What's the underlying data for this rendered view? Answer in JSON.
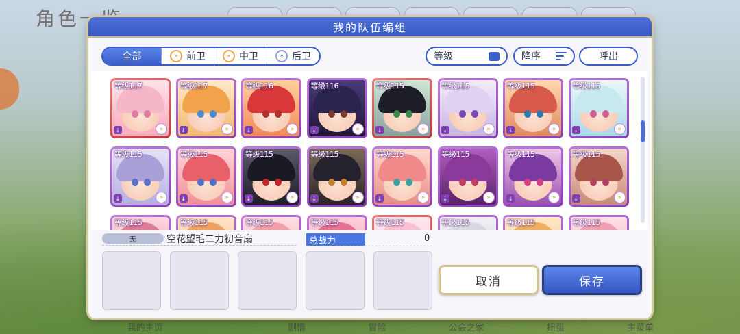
{
  "background": {
    "title": "角色一览",
    "bottom_nav": [
      "我的主页",
      "",
      "剧情",
      "冒险",
      "公会之家",
      "扭蛋",
      "主菜单"
    ]
  },
  "dialog": {
    "title": "我的队伍编组",
    "tabs": [
      {
        "label": "全部",
        "active": true
      },
      {
        "label": "前卫",
        "icon": "vanguard-icon"
      },
      {
        "label": "中卫",
        "icon": "midguard-icon"
      },
      {
        "label": "后卫",
        "icon": "rearguard-icon"
      }
    ],
    "sort_field": "等级",
    "sort_order": "降序",
    "call_button": "呼出",
    "characters": [
      {
        "level": "等级117",
        "frame": "red",
        "hair": "#f5b7c8",
        "eyes": "#e07aa0",
        "bg1": "#ffe3ea",
        "bg2": "#f7a9bc"
      },
      {
        "level": "等级117",
        "frame": "purple",
        "hair": "#f2a24a",
        "eyes": "#4a8ad0",
        "bg1": "#ffe9c8",
        "bg2": "#f0b870"
      },
      {
        "level": "等级116",
        "frame": "purple",
        "hair": "#d8383a",
        "eyes": "#b03030",
        "bg1": "#ffcf9a",
        "bg2": "#f08a5a"
      },
      {
        "level": "等级116",
        "frame": "purple",
        "hair": "#2b2350",
        "eyes": "#7a3a2a",
        "bg1": "#4a3a7a",
        "bg2": "#201838"
      },
      {
        "level": "等级115",
        "frame": "red",
        "hair": "#1e1e28",
        "eyes": "#3a8a4a",
        "bg1": "#cfe6d6",
        "bg2": "#8aa0a0"
      },
      {
        "level": "等级115",
        "frame": "purple",
        "hair": "#e0d2f0",
        "eyes": "#7a4ab0",
        "bg1": "#f4ecfb",
        "bg2": "#c8b4e0"
      },
      {
        "level": "等级115",
        "frame": "purple",
        "hair": "#d85a4a",
        "eyes": "#2a7ab0",
        "bg1": "#ffd8b0",
        "bg2": "#e08a60"
      },
      {
        "level": "等级115",
        "frame": "purple",
        "hair": "#c8e8f0",
        "eyes": "#d06090",
        "bg1": "#eaf8fc",
        "bg2": "#a8d8e8"
      },
      {
        "level": "等级115",
        "frame": "purple",
        "hair": "#a9a0d8",
        "eyes": "#5a70c0",
        "bg1": "#e6e4f8",
        "bg2": "#b4aee0"
      },
      {
        "level": "等级115",
        "frame": "purple",
        "hair": "#e8606a",
        "eyes": "#5070c0",
        "bg1": "#ffd4d8",
        "bg2": "#f09098"
      },
      {
        "level": "等级115",
        "frame": "purple",
        "hair": "#1a1a24",
        "eyes": "#c02828",
        "bg1": "#5a5a6a",
        "bg2": "#1e1e28"
      },
      {
        "level": "等级115",
        "frame": "purple",
        "hair": "#24222c",
        "eyes": "#c08030",
        "bg1": "#7a6a5a",
        "bg2": "#2a2228"
      },
      {
        "level": "等级115",
        "frame": "purple",
        "hair": "#f08a8a",
        "eyes": "#3aa0a0",
        "bg1": "#ffd8d0",
        "bg2": "#e88c88"
      },
      {
        "level": "等级115",
        "frame": "purple",
        "hair": "#8a3a9a",
        "eyes": "#c04060",
        "bg1": "#b060c0",
        "bg2": "#5a2068"
      },
      {
        "level": "等级115",
        "frame": "purple",
        "hair": "#7a3aa0",
        "eyes": "#d04080",
        "bg1": "#f0c8e8",
        "bg2": "#9a50b0"
      },
      {
        "level": "等级115",
        "frame": "purple",
        "hair": "#a8564a",
        "eyes": "#b04060",
        "bg1": "#f4d6cc",
        "bg2": "#c88a78"
      },
      {
        "level": "等级115",
        "frame": "purple",
        "hair": "#e07a9a",
        "eyes": "#a04060",
        "bg1": "#ffd8e0",
        "bg2": "#e090a8"
      },
      {
        "level": "等级115",
        "frame": "purple",
        "hair": "#f0a060",
        "eyes": "#4a80c0",
        "bg1": "#ffe4c8",
        "bg2": "#f0b080"
      },
      {
        "level": "等级115",
        "frame": "purple",
        "hair": "#f4a0a8",
        "eyes": "#c05070",
        "bg1": "#ffe0e4",
        "bg2": "#f0a8b0"
      },
      {
        "level": "等级115",
        "frame": "purple",
        "hair": "#e87090",
        "eyes": "#8040a0",
        "bg1": "#ffd0dc",
        "bg2": "#e890a8"
      },
      {
        "level": "等级115",
        "frame": "red",
        "hair": "#f8c0d0",
        "eyes": "#c06080",
        "bg1": "#ffe8f0",
        "bg2": "#f8b8c8"
      },
      {
        "level": "等级115",
        "frame": "purple",
        "hair": "#d8d8e0",
        "eyes": "#6070a0",
        "bg1": "#f0f0f4",
        "bg2": "#c8c8d8"
      },
      {
        "level": "等级115",
        "frame": "purple",
        "hair": "#f0b060",
        "eyes": "#5080c0",
        "bg1": "#ffe8c8",
        "bg2": "#f0c080"
      },
      {
        "level": "等级115",
        "frame": "purple",
        "hair": "#f0a0b0",
        "eyes": "#b05070",
        "bg1": "#ffe0e8",
        "bg2": "#f0a8b8"
      }
    ],
    "party": {
      "tag": "无",
      "name": "空花望毛二力初音扇",
      "power_label": "总战力",
      "power_value": "0"
    },
    "cancel_label": "取消",
    "save_label": "保存"
  }
}
